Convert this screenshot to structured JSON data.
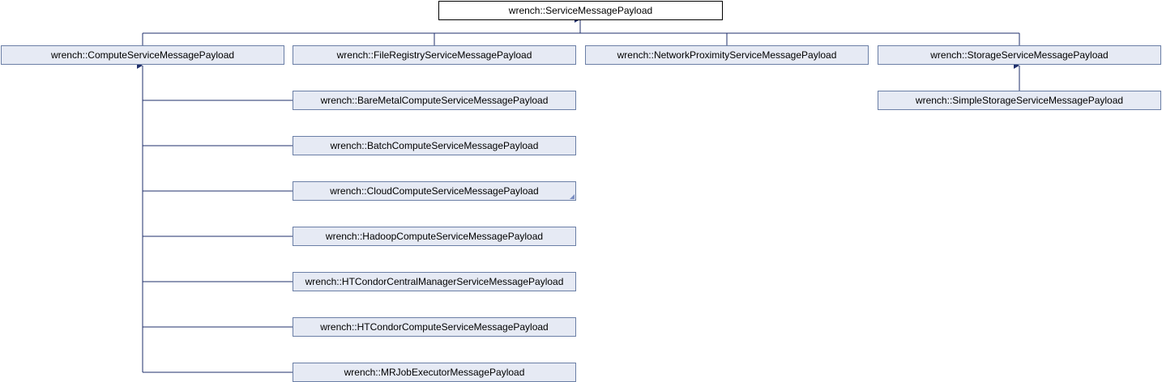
{
  "diagram": {
    "root": "wrench::ServiceMessagePayload",
    "level1": {
      "compute": "wrench::ComputeServiceMessagePayload",
      "file_registry": "wrench::FileRegistryServiceMessagePayload",
      "network_proximity": "wrench::NetworkProximityServiceMessagePayload",
      "storage": "wrench::StorageServiceMessagePayload"
    },
    "compute_children": [
      "wrench::BareMetalComputeServiceMessagePayload",
      "wrench::BatchComputeServiceMessagePayload",
      "wrench::CloudComputeServiceMessagePayload",
      "wrench::HadoopComputeServiceMessagePayload",
      "wrench::HTCondorCentralManagerServiceMessagePayload",
      "wrench::HTCondorComputeServiceMessagePayload",
      "wrench::MRJobExecutorMessagePayload"
    ],
    "storage_children": [
      "wrench::SimpleStorageServiceMessagePayload"
    ],
    "colors": {
      "node_fill": "#e6eaf4",
      "node_border": "#6b7fa6",
      "edge": "#1f2f6b",
      "root_border": "#000000"
    }
  }
}
